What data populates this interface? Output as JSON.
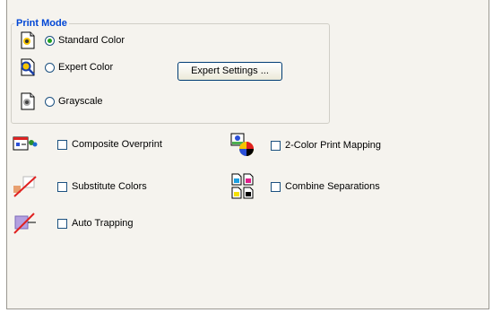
{
  "print_mode": {
    "title": "Print Mode",
    "options": [
      {
        "label": "Standard Color",
        "selected": true
      },
      {
        "label": "Expert Color",
        "selected": false
      },
      {
        "label": "Grayscale",
        "selected": false
      }
    ],
    "expert_settings_label": "Expert Settings ..."
  },
  "options_left": [
    {
      "label": "Composite Overprint",
      "checked": false
    },
    {
      "label": "Substitute Colors",
      "checked": false
    },
    {
      "label": "Auto Trapping",
      "checked": false
    }
  ],
  "options_right": [
    {
      "label": "2-Color Print Mapping",
      "checked": false
    },
    {
      "label": "Combine Separations",
      "checked": false
    }
  ],
  "colors": {
    "panel_bg": "#f5f3ee",
    "group_title": "#0046d5",
    "radio_dot": "#21a121",
    "control_border": "#1c5180"
  }
}
